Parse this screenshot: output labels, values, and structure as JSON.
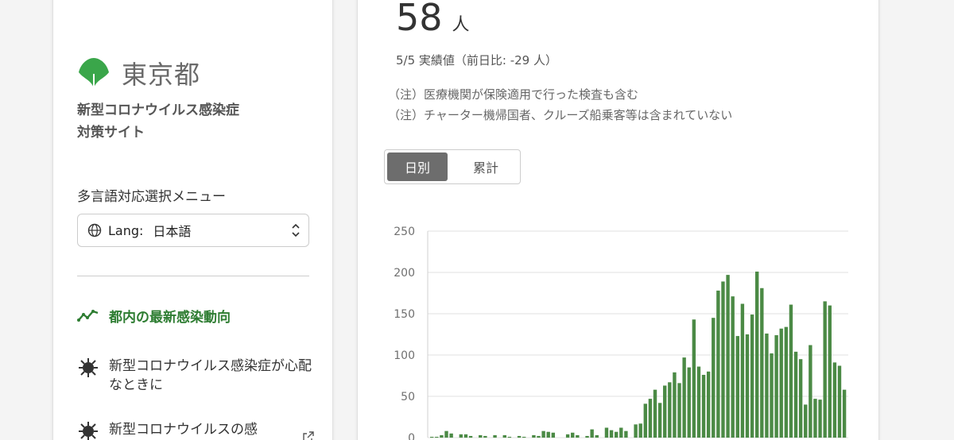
{
  "sidebar": {
    "logo_text": "東京都",
    "site_title_line1": "新型コロナウイルス感染症",
    "site_title_line2": "対策サイト",
    "lang_menu_label": "多言語対応選択メニュー",
    "lang_select": {
      "prefix": "Lang:",
      "value": "日本語"
    },
    "nav": [
      {
        "label": "都内の最新感染動向",
        "icon": "trend-line-icon",
        "active": true
      },
      {
        "label": "新型コロナウイルス感染症が心配なときに",
        "icon": "virus-icon"
      },
      {
        "label": "新型コロナウイルスの感",
        "icon": "virus-icon",
        "external": true
      }
    ],
    "colors": {
      "brand_green": "#3aa64a",
      "active_green": "#2e7d32"
    }
  },
  "main": {
    "count_value": "58",
    "count_unit": "人",
    "date_line": "5/5 実績値（前日比: -29 人）",
    "note1": "（注）医療機関が保険適用で行った検査も含む",
    "note2": "（注）チャーター機帰国者、クルーズ船乗客等は含まれていない",
    "toggle": {
      "daily": "日別",
      "cumulative": "累計",
      "selected": "daily"
    },
    "colors": {
      "bar": "#4b8a45",
      "toggle_active": "#6d6d6d"
    }
  },
  "chart_data": {
    "type": "bar",
    "ylim": [
      0,
      250
    ],
    "yticks": [
      0,
      50,
      100,
      150,
      200,
      250
    ],
    "grid": true,
    "values": [
      1,
      1,
      3,
      8,
      5,
      0,
      4,
      4,
      2,
      0,
      3,
      2,
      0,
      3,
      0,
      3,
      1,
      0,
      2,
      1,
      0,
      3,
      2,
      8,
      7,
      6,
      0,
      0,
      4,
      6,
      3,
      0,
      2,
      10,
      3,
      0,
      12,
      9,
      7,
      12,
      8,
      0,
      16,
      17,
      41,
      47,
      58,
      42,
      63,
      67,
      79,
      66,
      97,
      85,
      143,
      86,
      76,
      80,
      145,
      178,
      189,
      197,
      171,
      123,
      162,
      125,
      149,
      201,
      181,
      126,
      102,
      124,
      132,
      134,
      161,
      104,
      95,
      40,
      112,
      47,
      46,
      165,
      160,
      91,
      87,
      58
    ]
  }
}
